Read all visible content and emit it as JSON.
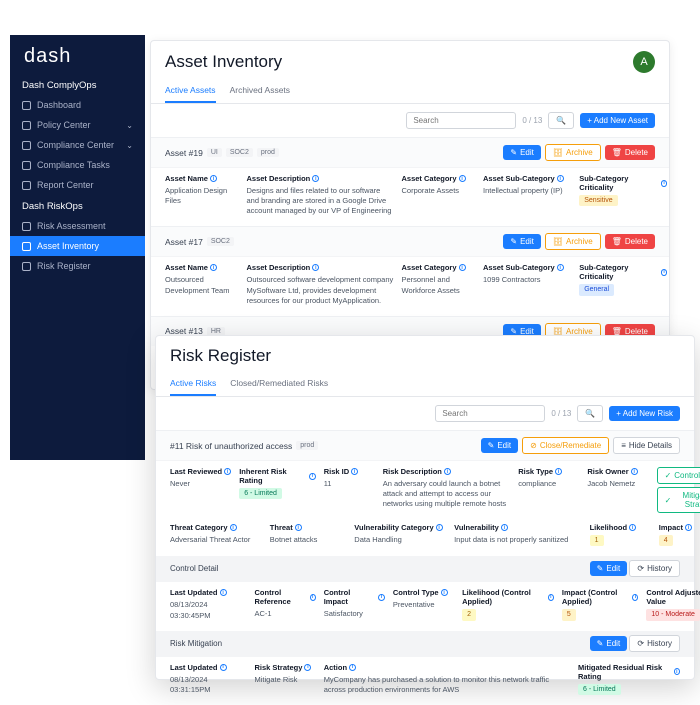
{
  "sidebar": {
    "logo": "dash",
    "section1": "Dash ComplyOps",
    "items1": [
      {
        "label": "Dashboard",
        "chev": false
      },
      {
        "label": "Policy Center",
        "chev": true
      },
      {
        "label": "Compliance Center",
        "chev": true
      },
      {
        "label": "Compliance Tasks",
        "chev": false
      },
      {
        "label": "Report Center",
        "chev": false
      }
    ],
    "section2": "Dash RiskOps",
    "items2": [
      {
        "label": "Risk Assessment",
        "active": false
      },
      {
        "label": "Asset Inventory",
        "active": true
      },
      {
        "label": "Risk Register",
        "active": false
      }
    ]
  },
  "asset": {
    "title": "Asset Inventory",
    "tabs": [
      "Active Assets",
      "Archived Assets"
    ],
    "search_ph": "Search",
    "counter": "0 / 13",
    "add": "+  Add New Asset",
    "edit": "Edit",
    "archive": "Archive",
    "delete": "Delete",
    "rows": [
      {
        "id": "Asset #19",
        "tags": [
          "UI",
          "SOC2",
          "prod"
        ]
      },
      {
        "id": "Asset #17",
        "tags": [
          "SOC2"
        ]
      },
      {
        "id": "Asset #13",
        "tags": [
          "HR"
        ]
      }
    ],
    "h": {
      "name": "Asset Name",
      "desc": "Asset Description",
      "cat": "Asset Category",
      "sub": "Asset Sub-Category",
      "crit": "Sub-Category Criticality"
    },
    "d1": {
      "name": "Application Design Files",
      "desc": "Designs and files related to our software and branding are stored in a Google Drive account managed by our VP of Engineering",
      "cat": "Corporate Assets",
      "sub": "Intellectual property (IP)",
      "crit": "Sensitive"
    },
    "d2": {
      "name": "Outsourced Development Team",
      "desc": "Outsourced software development company MySoftware Ltd, provides development resources for our product MyApplication.",
      "cat": "Personnel and Workforce Assets",
      "sub": "1099 Contractors",
      "crit": "General"
    }
  },
  "risk": {
    "title": "Risk Register",
    "tabs": [
      "Active Risks",
      "Closed/Remediated Risks"
    ],
    "search_ph": "Search",
    "counter": "0 / 13",
    "add": "+  Add New Risk",
    "row_id": "#11 Risk of unauthorized access",
    "row_tag": "prod",
    "edit": "Edit",
    "close": "Close/Remediate",
    "hide": "Hide Details",
    "control_btn": "Control Detail",
    "mitig_btn": "Mitigation Strategy",
    "history": "History",
    "h1": {
      "last": "Last Reviewed",
      "rating": "Inherent Risk Rating",
      "id": "Risk ID",
      "desc": "Risk Description",
      "type": "Risk Type",
      "owner": "Risk Owner"
    },
    "v1": {
      "last": "Never",
      "rating": "6 - Limited",
      "id": "11",
      "desc": "An adversary could launch a botnet attack and attempt to access our networks using multiple remote hosts",
      "type": "compliance",
      "owner": "Jacob Nemetz"
    },
    "h2": {
      "tc": "Threat Category",
      "t": "Threat",
      "vc": "Vulnerability Category",
      "v": "Vulnerability",
      "l": "Likelihood",
      "i": "Impact"
    },
    "v2": {
      "tc": "Adversarial Threat Actor",
      "t": "Botnet attacks",
      "vc": "Data Handling",
      "v": "Input data is not properly sanitized",
      "l": "1",
      "i": "4"
    },
    "s1": "Control Detail",
    "h3": {
      "lu": "Last Updated",
      "cr": "Control Reference",
      "ci": "Control Impact",
      "ct": "Control Type",
      "lc": "Likelihood (Control Applied)",
      "ic": "Impact (Control Applied)",
      "ar": "Control Adjusted Risk Value"
    },
    "v3": {
      "lu": "08/13/2024 03:30:45PM",
      "cr": "AC-1",
      "ci": "Satisfactory",
      "ct": "Preventative",
      "lc": "2",
      "ic": "5",
      "ar": "10 - Moderate"
    },
    "s2": "Risk Mitigation",
    "h4": {
      "lu": "Last Updated",
      "rs": "Risk Strategy",
      "a": "Action",
      "mr": "Mitigated Residual Risk Rating"
    },
    "v4": {
      "lu": "08/13/2024 03:31:15PM",
      "rs": "Mitigate Risk",
      "a": "MyCompany has purchased a solution to monitor this network traffic across production environments for AWS",
      "mr": "6 - Limited"
    }
  }
}
